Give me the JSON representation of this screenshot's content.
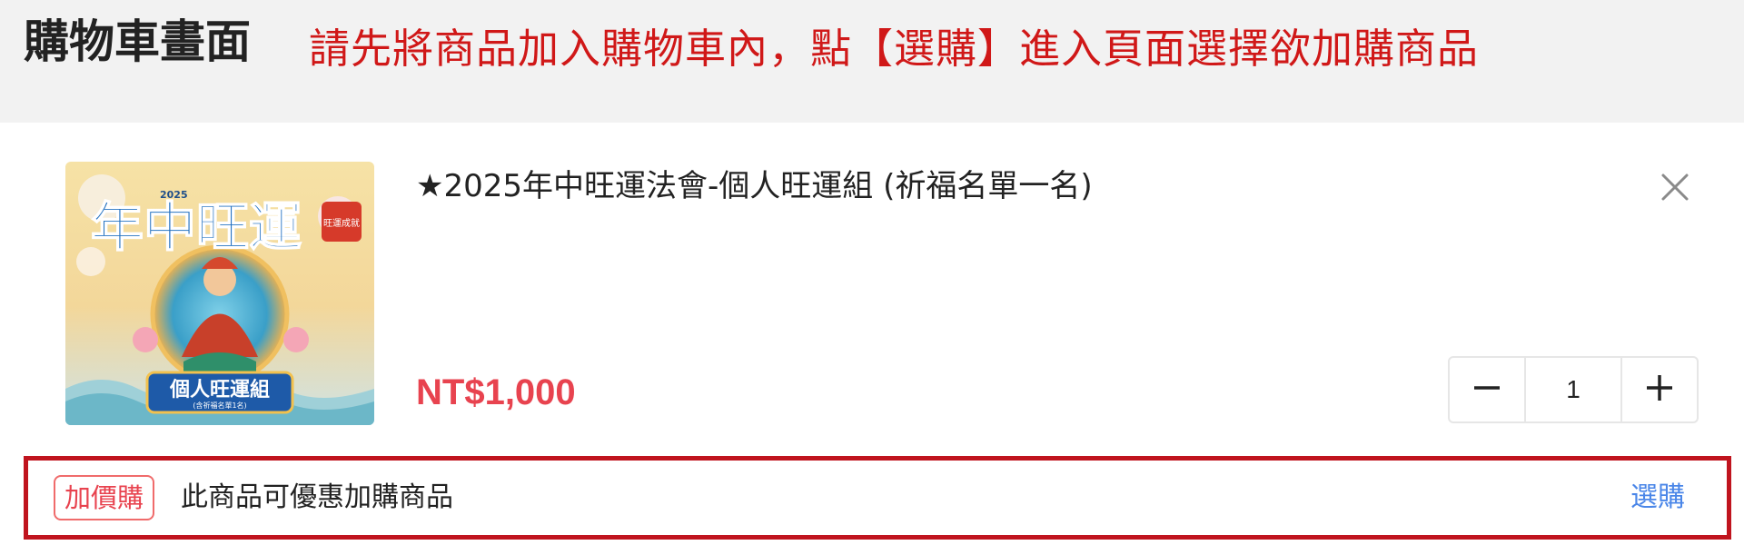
{
  "header": {
    "page_title": "購物車畫面",
    "instruction": "請先將商品加入購物車內，點【選購】進入頁面選擇欲加購商品"
  },
  "cart_item": {
    "title": "★2025年中旺運法會-個人旺運組 (祈福名單一名)",
    "price": "NT$1,000",
    "quantity": "1",
    "image": {
      "banner_text": "年中旺運",
      "year_text": "2025",
      "seal_text": "旺運成就",
      "label_text": "個人旺運組",
      "sub_label_text": "(含祈福名單1名)"
    }
  },
  "addon": {
    "badge": "加價購",
    "text": "此商品可優惠加購商品",
    "link": "選購"
  },
  "icons": {
    "remove": "close-icon",
    "decrease": "minus-icon",
    "increase": "plus-icon"
  },
  "colors": {
    "instruction": "#d01818",
    "price": "#e8434f",
    "highlight_border": "#c0141e",
    "link": "#4a86e8",
    "badge": "#e8434f"
  }
}
